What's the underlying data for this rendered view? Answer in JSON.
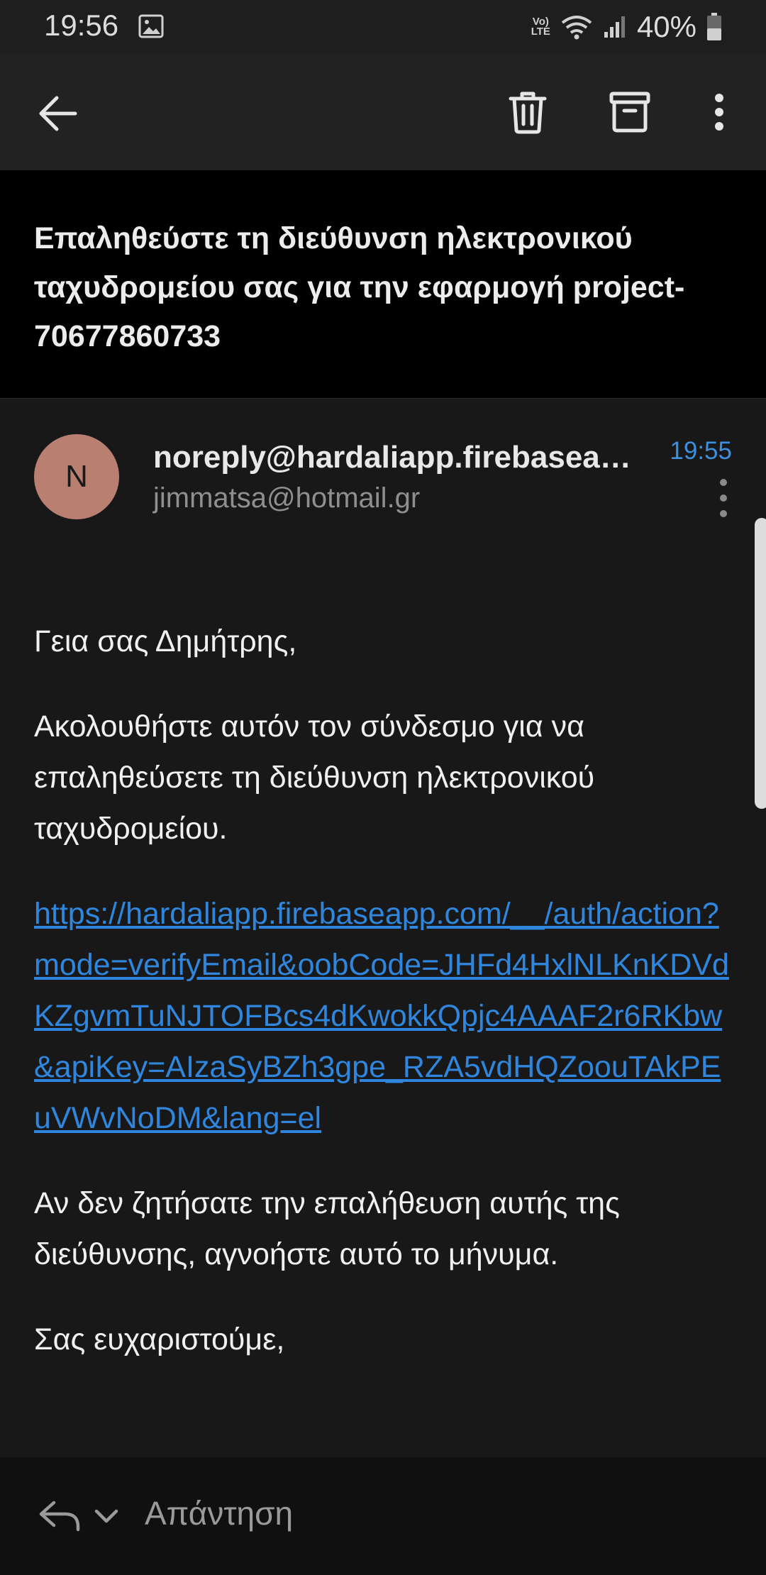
{
  "status_bar": {
    "time": "19:56",
    "network_label_top": "Vo)",
    "network_label_bottom": "LTE",
    "battery": "40%"
  },
  "toolbar": {
    "back_icon": "arrow-left-icon",
    "delete_icon": "trash-icon",
    "archive_icon": "archive-icon",
    "more_icon": "more-vertical-icon"
  },
  "email": {
    "subject": "Επαληθεύστε τη διεύθυνση ηλεκτρονικού ταχυδρομείου σας για την εφαρμογή project-70677860733",
    "avatar_letter": "N",
    "sender": "noreply@hardaliapp.firebaseapp.com",
    "recipient": "jimmatsa@hotmail.gr",
    "time": "19:55",
    "body": {
      "greeting": "Γεια σας Δημήτρης,",
      "instruction": "Ακολουθήστε αυτόν τον σύνδεσμο για να επαληθεύσετε τη διεύθυνση ηλεκτρονικού ταχυδρομείου.",
      "link": "https://hardaliapp.firebaseapp.com/__/auth/action?mode=verifyEmail&oobCode=JHFd4HxlNLKnKDVdKZgvmTuNJTOFBcs4dKwokkQpjc4AAAF2r6RKbw&apiKey=AIzaSyBZh3gpe_RZA5vdHQZoouTAkPEuVWvNoDM&lang=el",
      "ignore_note": "Αν δεν ζητήσατε την επαλήθευση αυτής της διεύθυνσης, αγνοήστε αυτό το μήνυμα.",
      "closing": "Σας ευχαριστούμε,"
    }
  },
  "bottom_bar": {
    "reply_label": "Απάντηση"
  },
  "colors": {
    "link": "#2f86dc",
    "time_accent": "#3d8fe0",
    "avatar": "#b98072"
  }
}
